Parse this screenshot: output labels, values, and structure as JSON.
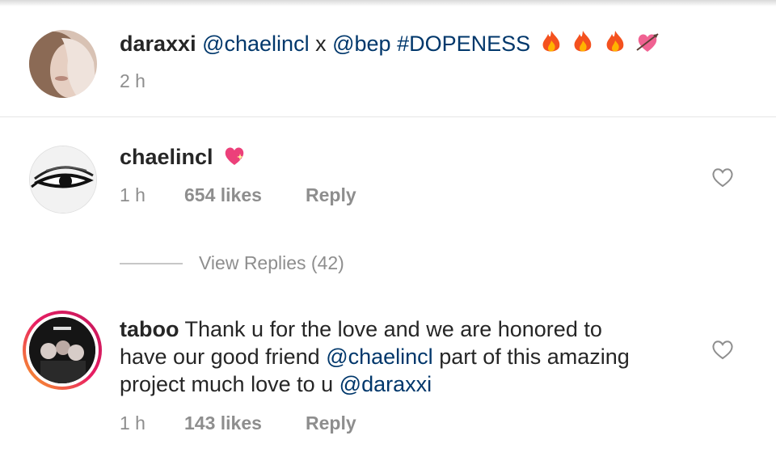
{
  "post": {
    "username": "daraxxi",
    "mention1": "@chaelincl",
    "separator": "x",
    "mention2": "@bep",
    "hashtag": "#DOPENESS",
    "emojis": [
      "fire",
      "fire",
      "fire",
      "heart-with-arrow"
    ],
    "time": "2 h"
  },
  "comments": [
    {
      "username": "chaelincl",
      "emoji": "sparkling-heart",
      "time": "1 h",
      "likes": "654 likes",
      "reply_label": "Reply",
      "view_replies": "View Replies (42)"
    },
    {
      "username": "taboo",
      "text_line1": "Thank u for the love and we are honored to",
      "text_line2_a": "have our good friend",
      "text_line2_mention": "@chaelincl",
      "text_line2_b": "part of this amazing",
      "text_line3_a": "project much love to u",
      "text_line3_mention": "@daraxxi",
      "time": "1 h",
      "likes": "143 likes",
      "reply_label": "Reply"
    }
  ],
  "colors": {
    "mention": "#00376b",
    "meta": "#8e8e8e",
    "text": "#262626"
  }
}
